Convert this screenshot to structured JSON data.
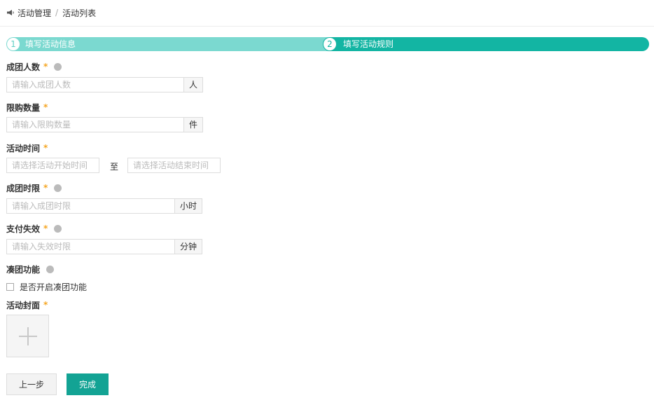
{
  "breadcrumb": {
    "root": "活动管理",
    "separator": "/",
    "current": "活动列表"
  },
  "steps": [
    {
      "num": "1",
      "label": "填写活动信息"
    },
    {
      "num": "2",
      "label": "填写活动规则"
    }
  ],
  "form": {
    "group_size": {
      "label": "成团人数",
      "required": "*",
      "placeholder": "请输入成团人数",
      "addon": "人"
    },
    "purchase_limit": {
      "label": "限购数量",
      "required": "*",
      "placeholder": "请输入限购数量",
      "addon": "件"
    },
    "activity_time": {
      "label": "活动时间",
      "required": "*",
      "start_placeholder": "请选择活动开始时间",
      "to": "至",
      "end_placeholder": "请选择活动结束时间"
    },
    "group_time_limit": {
      "label": "成团时限",
      "required": "*",
      "placeholder": "请输入成团时限",
      "addon": "小时"
    },
    "payment_expiry": {
      "label": "支付失效",
      "required": "*",
      "placeholder": "请输入失效时限",
      "addon": "分钟"
    },
    "auto_group": {
      "label": "凑团功能",
      "checkbox_label": "是否开启凑团功能"
    },
    "cover": {
      "label": "活动封面",
      "required": "*"
    }
  },
  "buttons": {
    "prev": "上一步",
    "done": "完成"
  },
  "colors": {
    "step_done": "#7bd9d0",
    "step_active": "#13b5a3",
    "primary": "#13a394",
    "required": "#f5a623"
  }
}
